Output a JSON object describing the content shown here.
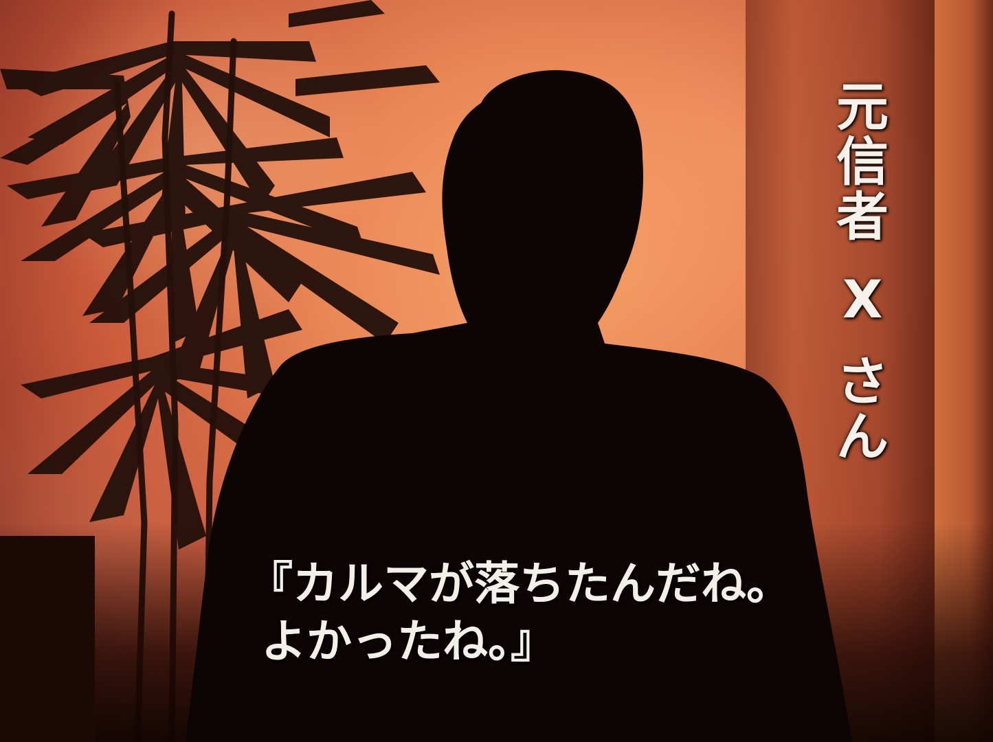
{
  "scene": {
    "vertical_caption": {
      "chars": [
        "元",
        "信",
        "者",
        "X",
        "さ",
        "ん"
      ]
    },
    "subtitle": {
      "line1": "『カルマが落ちたんだね。",
      "line2": "よかったね。』"
    }
  }
}
